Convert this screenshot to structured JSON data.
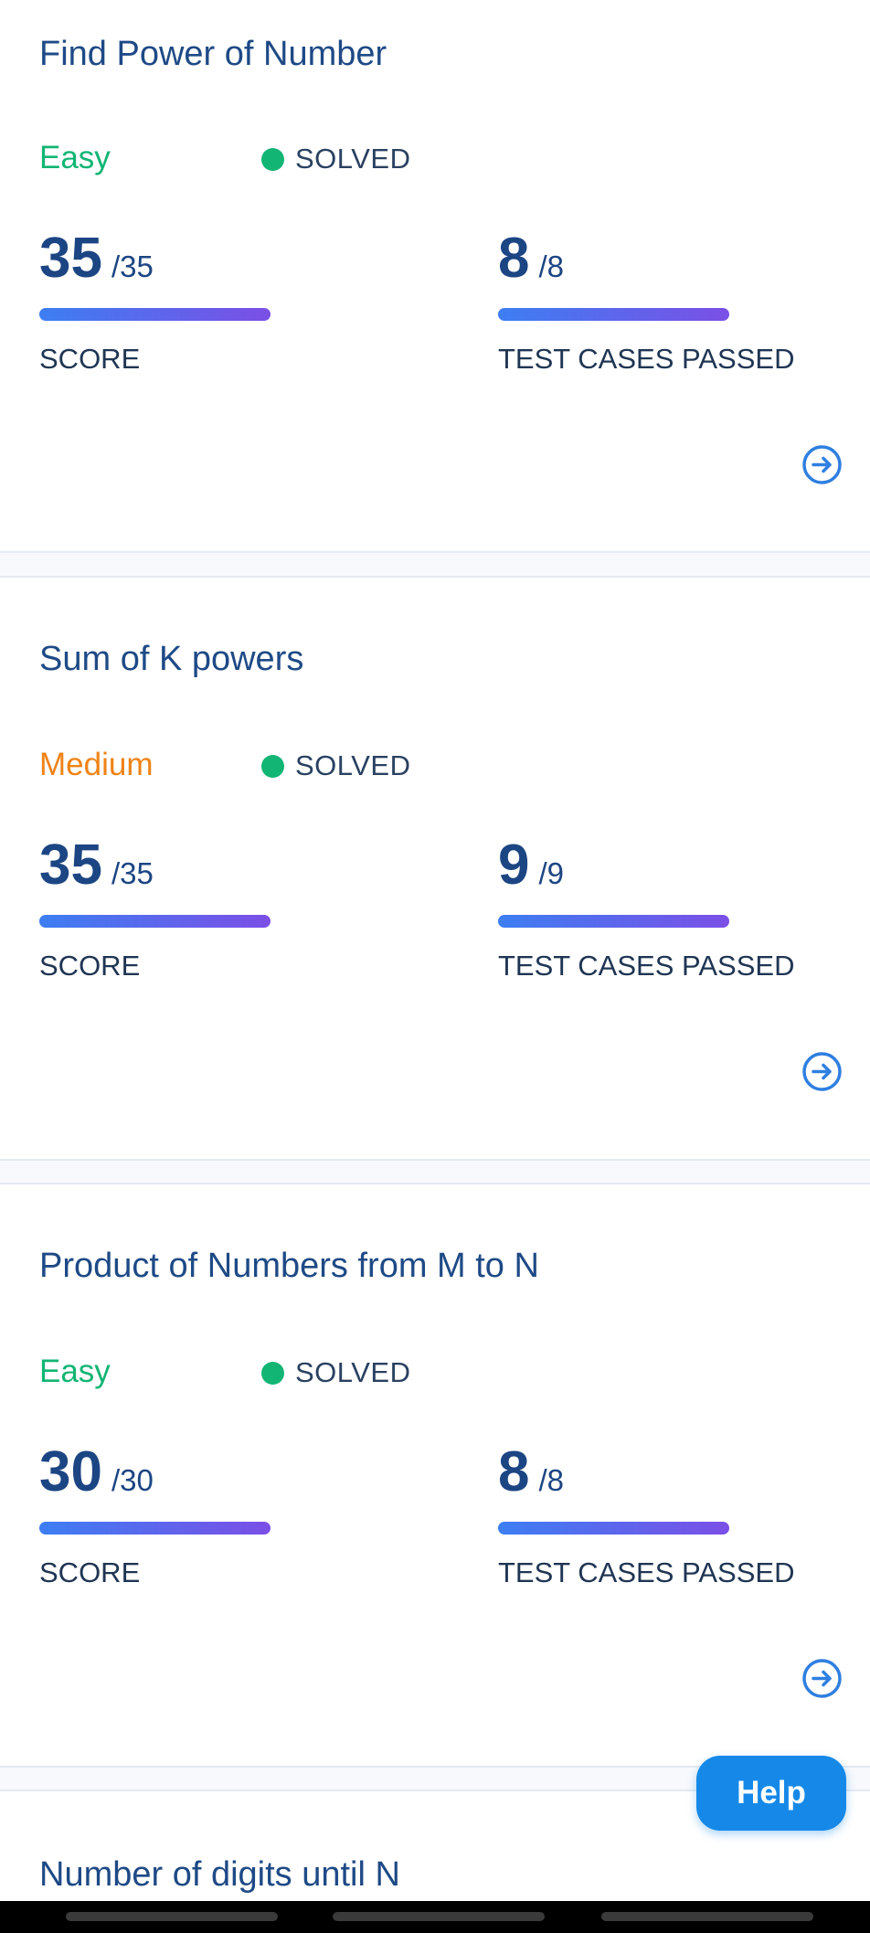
{
  "problems": [
    {
      "title": "Find Power of Number",
      "difficulty": "Easy",
      "status": "SOLVED",
      "score": {
        "value": "35",
        "total": "/35",
        "label": "SCORE",
        "fraction": 1.0
      },
      "tests": {
        "value": "8",
        "total": "/8",
        "label": "TEST CASES PASSED",
        "fraction": 1.0
      }
    },
    {
      "title": "Sum of K powers",
      "difficulty": "Medium",
      "status": "SOLVED",
      "score": {
        "value": "35",
        "total": "/35",
        "label": "SCORE",
        "fraction": 1.0
      },
      "tests": {
        "value": "9",
        "total": "/9",
        "label": "TEST CASES PASSED",
        "fraction": 1.0
      }
    },
    {
      "title": "Product of Numbers from M to N",
      "difficulty": "Easy",
      "status": "SOLVED",
      "score": {
        "value": "30",
        "total": "/30",
        "label": "SCORE",
        "fraction": 1.0
      },
      "tests": {
        "value": "8",
        "total": "/8",
        "label": "TEST CASES PASSED",
        "fraction": 1.0
      }
    },
    {
      "title": "Number of digits until N"
    }
  ],
  "help_button": {
    "label": "Help"
  },
  "colors": {
    "easy": "#12b574",
    "medium": "#ef8316",
    "solved_dot": "#12b574",
    "title": "#1e4a86",
    "accent": "#1689e8",
    "bar_start": "#3d7ef2",
    "bar_end": "#7b4fe6"
  },
  "icons": {
    "open_problem": "arrow-right-circle-icon",
    "status": "solved-dot-icon"
  }
}
